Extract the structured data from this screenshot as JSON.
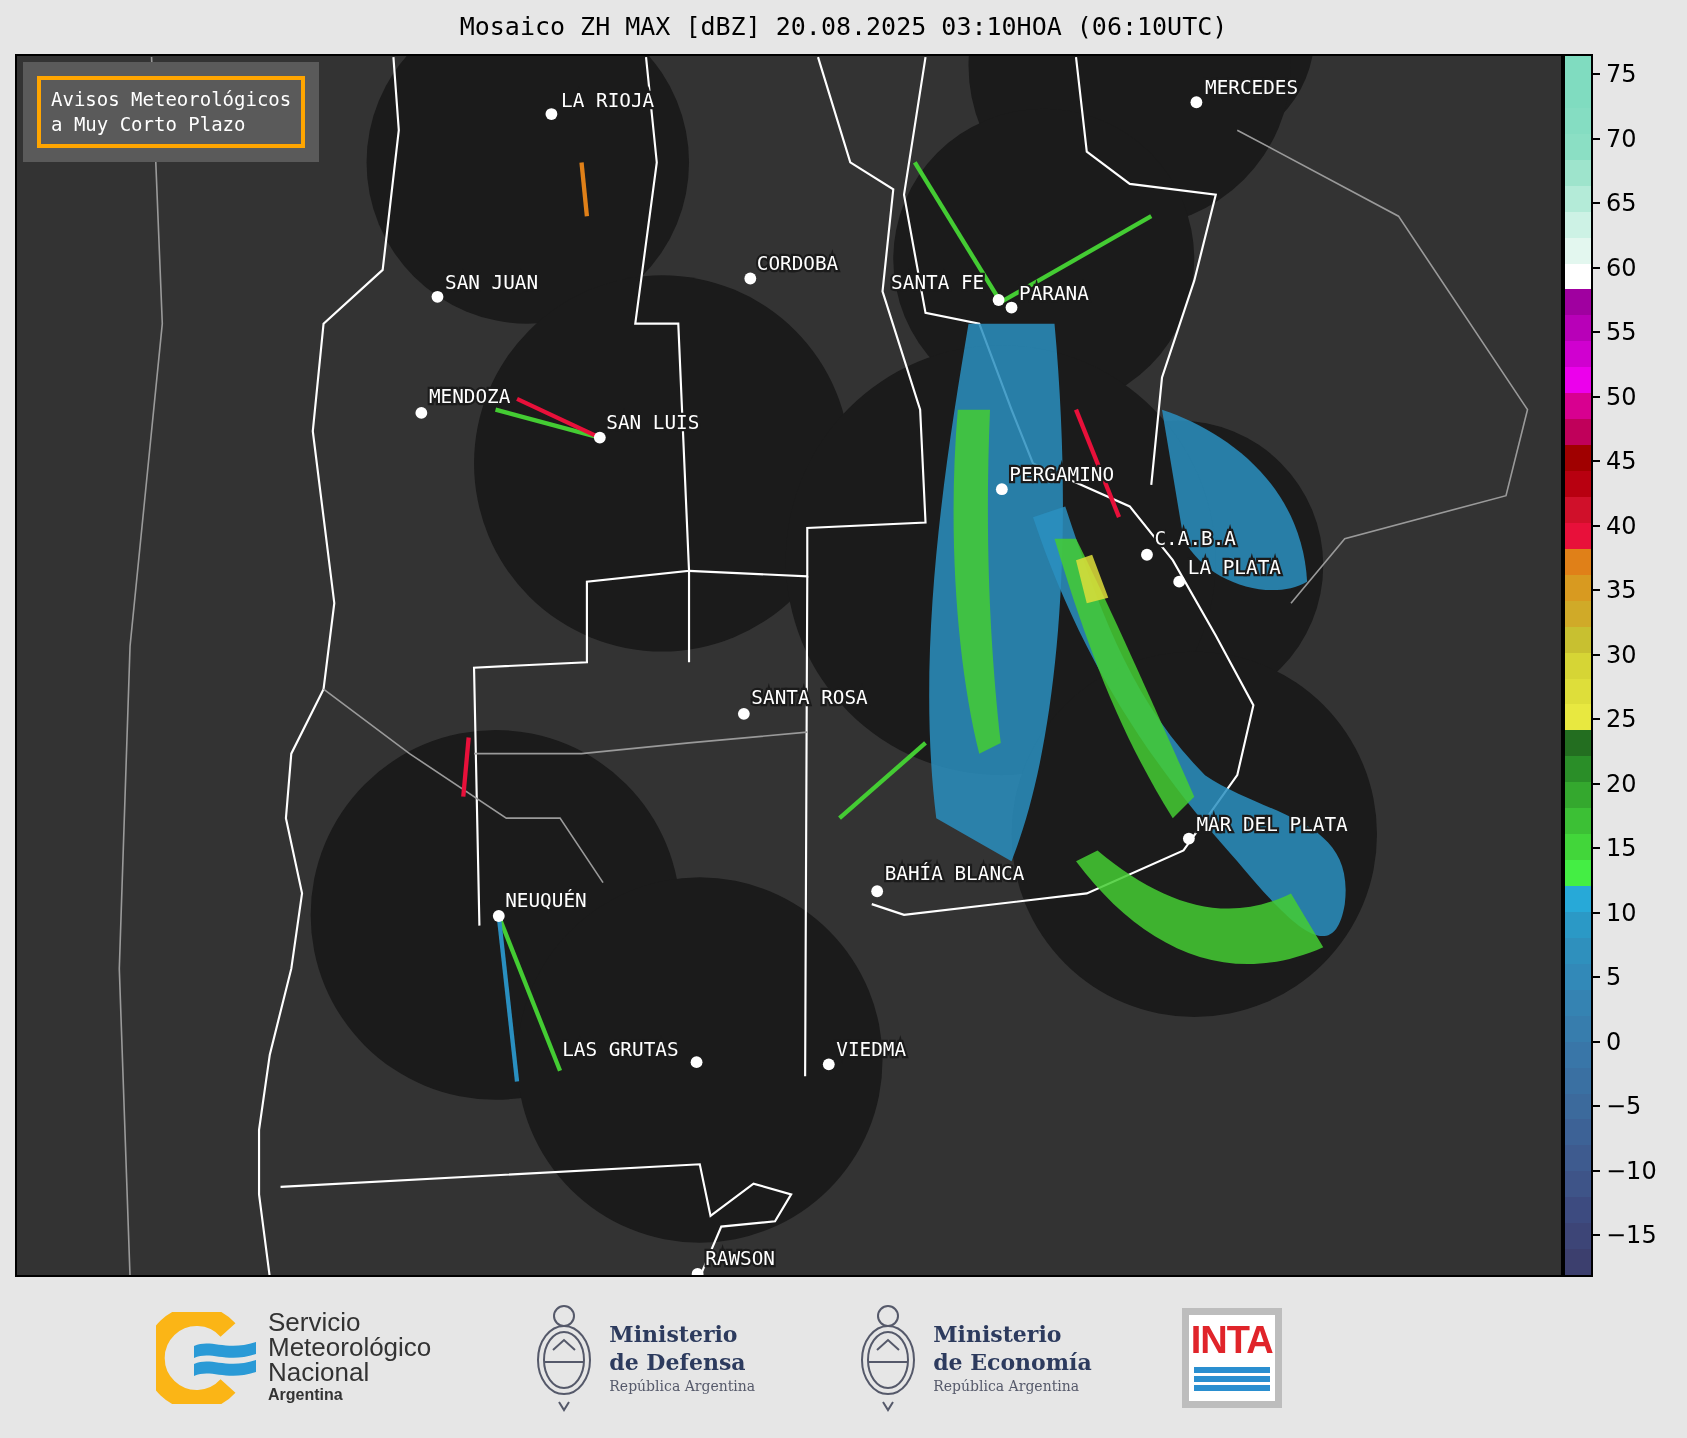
{
  "title": "Mosaico ZH MAX [dBZ] 20.08.2025 03:10HOA (06:10UTC)",
  "notice": {
    "lines": [
      "Avisos Meteorológicos",
      "a Muy Corto Plazo"
    ]
  },
  "cities": [
    {
      "name": "LA RIOJA"
    },
    {
      "name": "MERCEDES"
    },
    {
      "name": "SAN JUAN"
    },
    {
      "name": "CORDOBA"
    },
    {
      "name": "SANTA FE"
    },
    {
      "name": "PARANA"
    },
    {
      "name": "MENDOZA"
    },
    {
      "name": "SAN LUIS"
    },
    {
      "name": "PERGAMINO"
    },
    {
      "name": "C.A.B.A"
    },
    {
      "name": "LA PLATA"
    },
    {
      "name": "SANTA ROSA"
    },
    {
      "name": "MAR DEL PLATA"
    },
    {
      "name": "BAHÍA BLANCA"
    },
    {
      "name": "NEUQUÉN"
    },
    {
      "name": "LAS GRUTAS"
    },
    {
      "name": "VIEDMA"
    },
    {
      "name": "RAWSON"
    }
  ],
  "colorbar": {
    "ticks": [
      "75",
      "70",
      "65",
      "60",
      "55",
      "50",
      "45",
      "40",
      "35",
      "30",
      "25",
      "20",
      "15",
      "10",
      "5",
      "0",
      "−5",
      "−10",
      "−15"
    ]
  },
  "footer": {
    "logos": [
      {
        "kind": "smn",
        "lines": [
          "Servicio",
          "Meteorológico",
          "Nacional",
          "Argentina"
        ]
      },
      {
        "kind": "ministry",
        "lines": [
          "Ministerio",
          "de Defensa",
          "República Argentina"
        ]
      },
      {
        "kind": "ministry",
        "lines": [
          "Ministerio",
          "de Economía",
          "República Argentina"
        ]
      },
      {
        "kind": "inta",
        "lines": [
          "INTA"
        ]
      }
    ]
  }
}
